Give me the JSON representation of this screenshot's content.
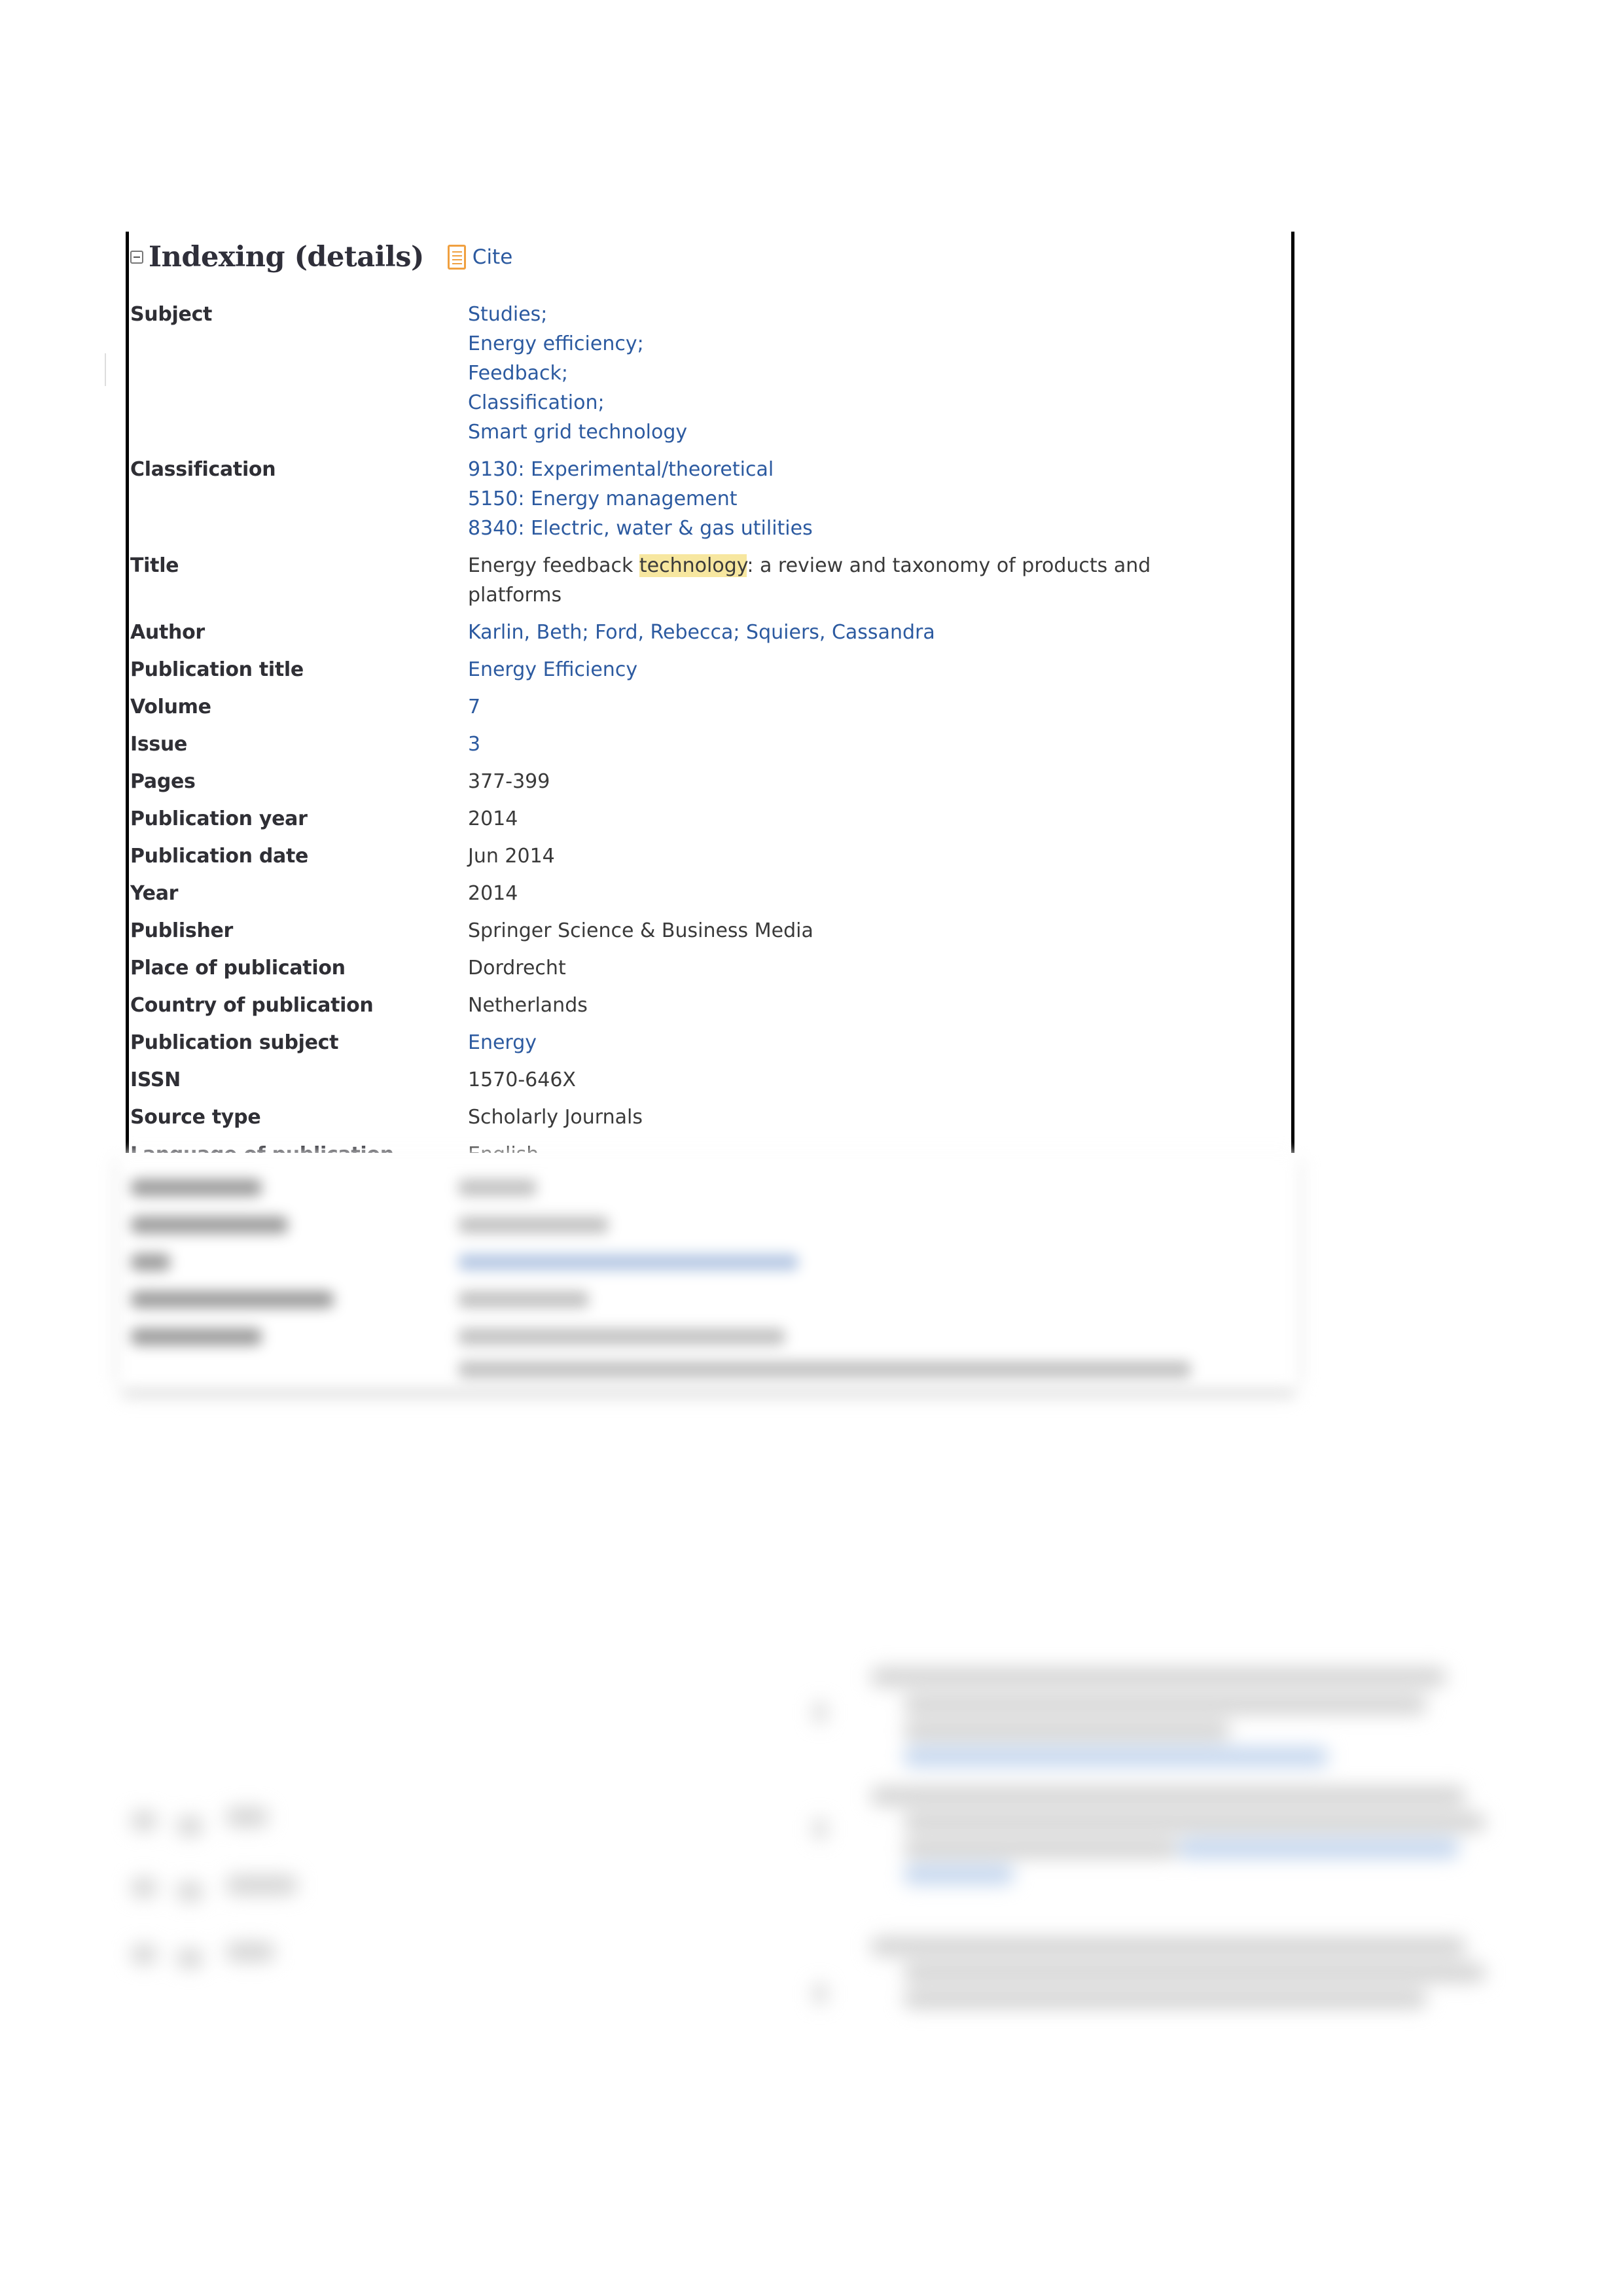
{
  "section": {
    "title": "Indexing (details)",
    "toggle_icon": "collapse-minus-icon",
    "cite_label": "Cite",
    "cite_icon": "document-lines-icon"
  },
  "colors": {
    "link": "#2c5aa0",
    "text": "#3a3a3a",
    "label": "#2f2f35",
    "highlight": "#f7e7a0",
    "cite_icon": "#f0a040"
  },
  "fields": {
    "subject": {
      "label": "Subject",
      "values": [
        "Studies;",
        "Energy efficiency;",
        "Feedback;",
        "Classification;",
        "Smart grid technology"
      ]
    },
    "classification": {
      "label": "Classification",
      "values": [
        "9130: Experimental/theoretical",
        "5150: Energy management",
        "8340: Electric, water & gas utilities"
      ]
    },
    "title": {
      "label": "Title",
      "before": "Energy feedback ",
      "highlight": "technology",
      "after": ": a review and taxonomy of products and platforms"
    },
    "author": {
      "label": "Author",
      "values": [
        "Karlin, Beth",
        "Ford, Rebecca",
        "Squiers, Cassandra"
      ],
      "sep": "; "
    },
    "publication_title": {
      "label": "Publication title",
      "value": "Energy Efficiency"
    },
    "volume": {
      "label": "Volume",
      "value": "7"
    },
    "issue": {
      "label": "Issue",
      "value": "3"
    },
    "pages": {
      "label": "Pages",
      "value": "377-399"
    },
    "publication_year": {
      "label": "Publication year",
      "value": "2014"
    },
    "publication_date": {
      "label": "Publication date",
      "value": "Jun 2014"
    },
    "year": {
      "label": "Year",
      "value": "2014"
    },
    "publisher": {
      "label": "Publisher",
      "value": "Springer Science & Business Media"
    },
    "place_of_publication": {
      "label": "Place of publication",
      "value": "Dordrecht"
    },
    "country_of_publication": {
      "label": "Country of publication",
      "value": "Netherlands"
    },
    "publication_subject": {
      "label": "Publication subject",
      "value": "Energy"
    },
    "issn": {
      "label": "ISSN",
      "value": "1570-646X"
    },
    "source_type": {
      "label": "Source type",
      "value": "Scholarly Journals"
    },
    "language_of_publication": {
      "label": "Language of publication",
      "value": "English"
    }
  }
}
